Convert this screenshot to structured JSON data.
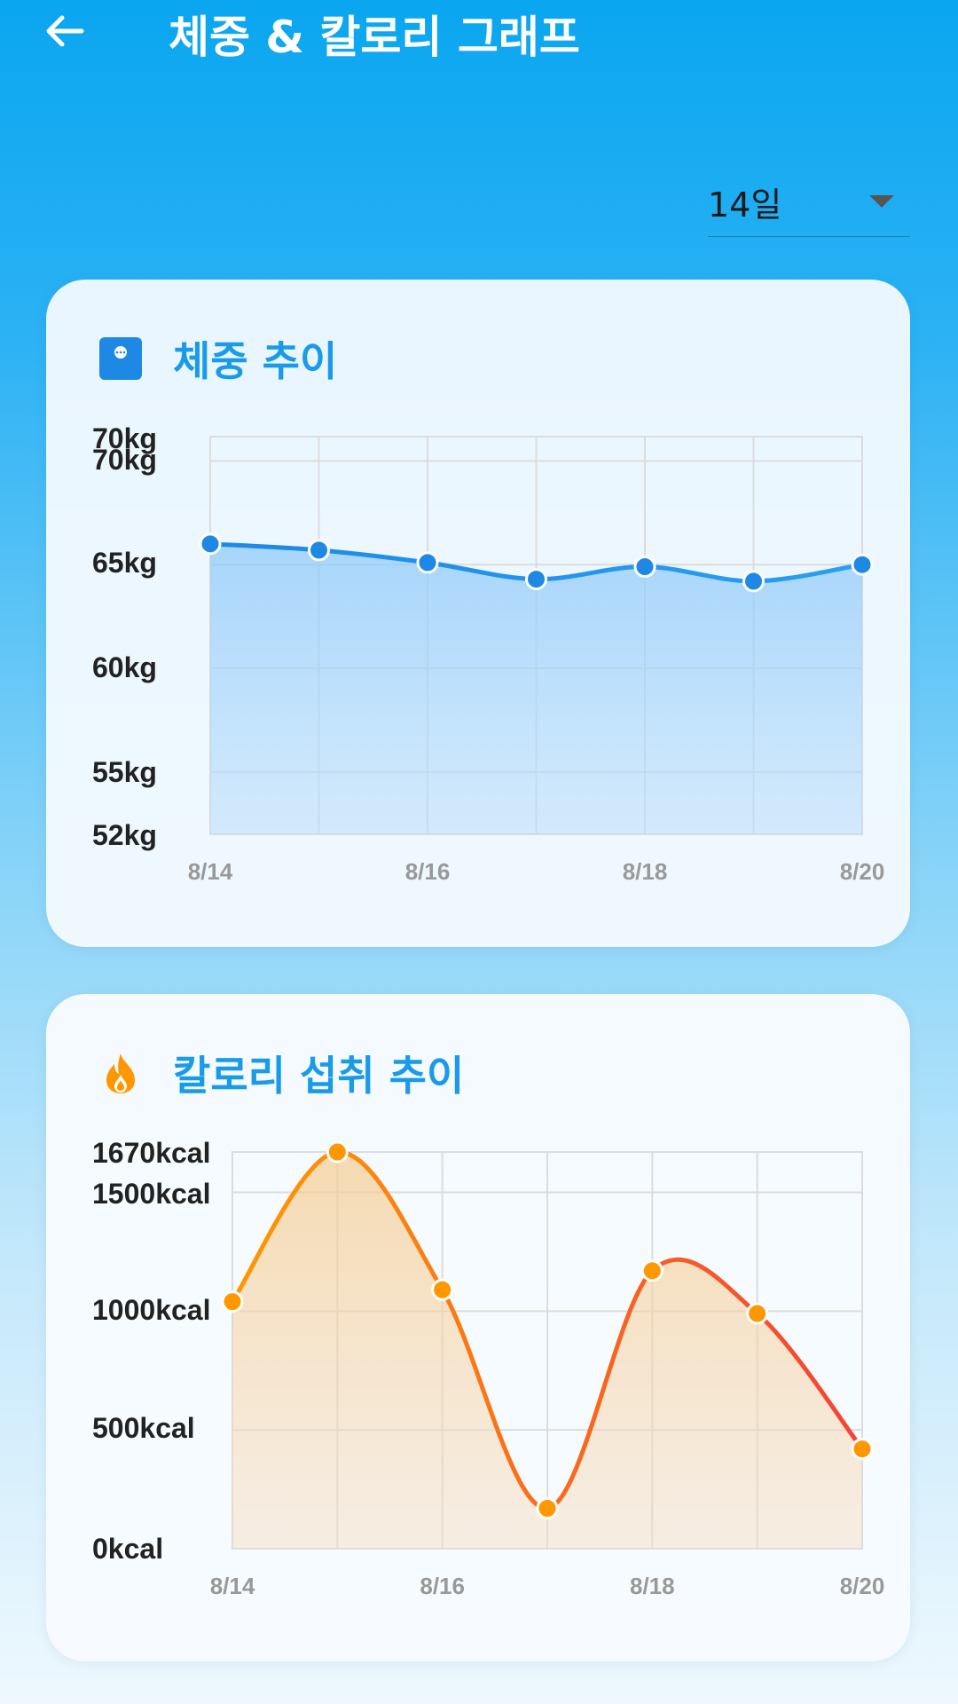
{
  "header": {
    "title": "체중 & 칼로리 그래프",
    "back_icon": "arrow-left-icon"
  },
  "period_select": {
    "value": "14일"
  },
  "weight_card": {
    "title": "체중 추이",
    "icon": "scale-icon",
    "color": "#2196f3"
  },
  "calorie_card": {
    "title": "칼로리 섭취 추이",
    "icon": "fire-icon",
    "color": "#ff9800"
  },
  "chart_data": [
    {
      "type": "line",
      "categories": [
        "8/14",
        "8/15",
        "8/16",
        "8/17",
        "8/18",
        "8/19",
        "8/20"
      ],
      "x_tick_labels": [
        "8/14",
        "8/16",
        "8/18",
        "8/20"
      ],
      "y_tick_labels": [
        "70kg",
        "70kg",
        "65kg",
        "60kg",
        "55kg",
        "52kg"
      ],
      "series": [
        {
          "values": [
            66.0,
            65.7,
            65.1,
            64.3,
            64.9,
            64.2,
            65.0
          ]
        }
      ],
      "ylim": [
        52,
        71
      ],
      "grid": true,
      "fill": "area"
    },
    {
      "type": "line",
      "categories": [
        "8/14",
        "8/15",
        "8/16",
        "8/17",
        "8/18",
        "8/19",
        "8/20"
      ],
      "x_tick_labels": [
        "8/14",
        "8/16",
        "8/18",
        "8/20"
      ],
      "y_tick_labels": [
        "1670kcal",
        "1500kcal",
        "1000kcal",
        "500kcal",
        "0kcal"
      ],
      "series": [
        {
          "values": [
            1040,
            1670,
            1090,
            170,
            1170,
            990,
            420
          ]
        }
      ],
      "ylim": [
        0,
        1670
      ],
      "grid": true,
      "fill": "area"
    }
  ]
}
